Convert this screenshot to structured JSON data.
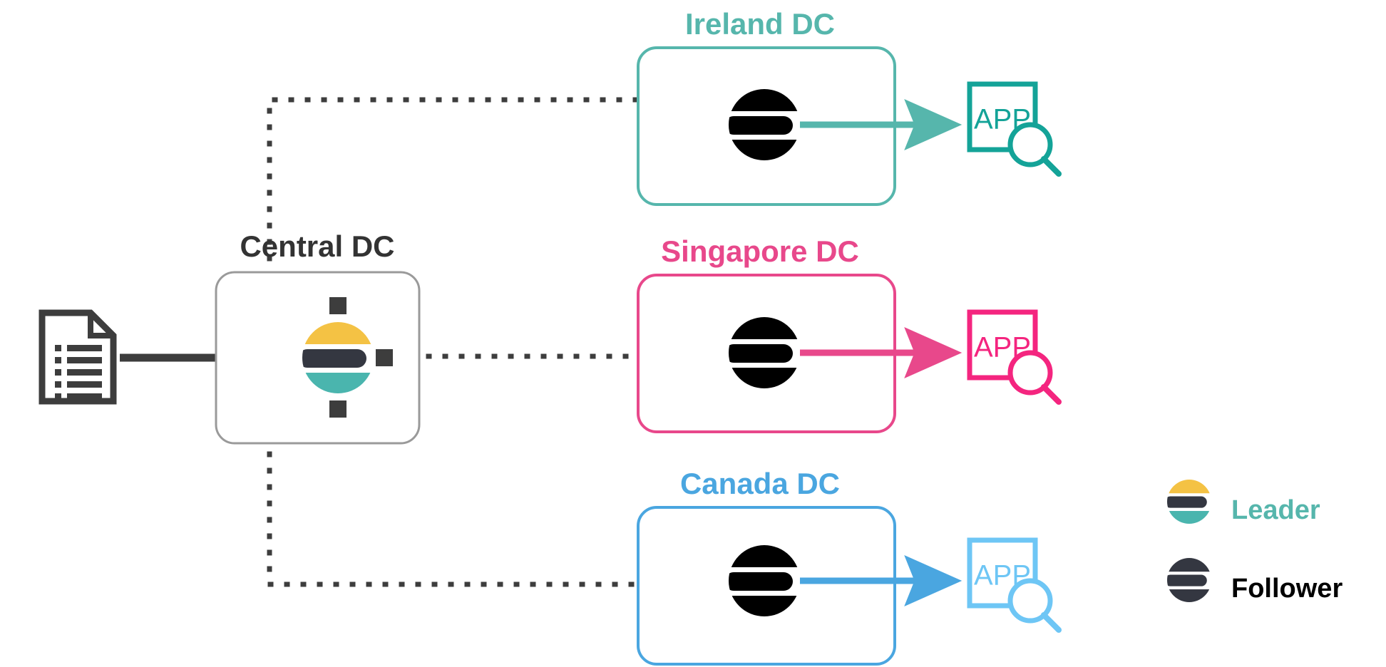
{
  "diagram": {
    "title_hidden": "",
    "background": "#ffffff"
  },
  "colors": {
    "ireland": "#56b6ac",
    "ireland_app": "#14a398",
    "singapore": "#e8488b",
    "singapore_app": "#f4257f",
    "canada": "#4aa6e0",
    "canada_app": "#6ec6f5",
    "central_border": "#9a9a9a",
    "dark": "#3d3d3d",
    "navy": "#343741",
    "leader_yellow": "#f4c244",
    "leader_teal": "#4ab5ae",
    "follower_black": "#000000",
    "legend_leader_text": "#56b6ac",
    "legend_follower_text": "#000000",
    "central_title": "#333333"
  },
  "source": {
    "icon": "document-icon",
    "label": ""
  },
  "central": {
    "title": "Central DC",
    "node_role": "leader",
    "node_icon": "elasticsearch-node-icon",
    "connectors": [
      "top-connector",
      "right-connector",
      "bottom-connector"
    ]
  },
  "clusters": [
    {
      "id": "ireland",
      "title": "Ireland DC",
      "color": "#56b6ac",
      "app_color": "#14a398",
      "node_role": "follower",
      "node_icon": "elasticsearch-node-icon",
      "app_label": "APP",
      "app_icon": "app-search-icon"
    },
    {
      "id": "singapore",
      "title": "Singapore DC",
      "color": "#e8488b",
      "app_color": "#f4257f",
      "node_role": "follower",
      "node_icon": "elasticsearch-node-icon",
      "app_label": "APP",
      "app_icon": "app-search-icon"
    },
    {
      "id": "canada",
      "title": "Canada DC",
      "color": "#4aa6e0",
      "app_color": "#6ec6f5",
      "node_role": "follower",
      "node_icon": "elasticsearch-node-icon",
      "app_label": "APP",
      "app_icon": "app-search-icon"
    }
  ],
  "legend": {
    "items": [
      {
        "id": "leader",
        "label": "Leader",
        "text_color": "#56b6ac",
        "icon": "elasticsearch-leader-icon"
      },
      {
        "id": "follower",
        "label": "Follower",
        "text_color": "#000000",
        "icon": "elasticsearch-follower-icon"
      }
    ]
  }
}
